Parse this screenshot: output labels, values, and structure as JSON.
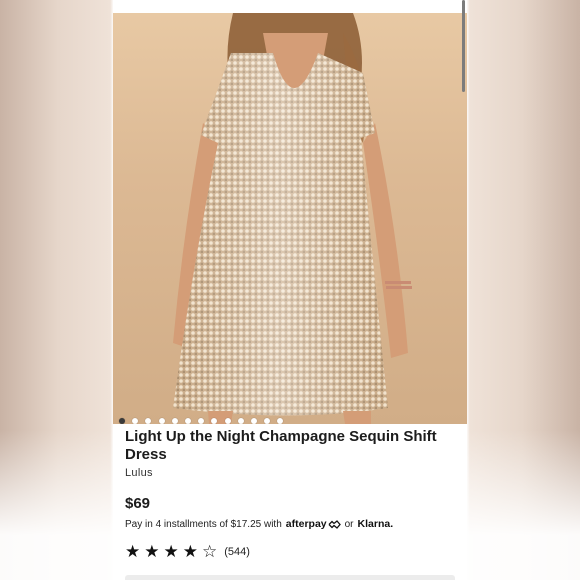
{
  "product": {
    "title": "Light Up the Night Champagne Sequin Shift Dress",
    "brand": "Lulus",
    "price": "$69",
    "installments_text": "Pay in 4 installments of $17.25 with",
    "afterpay_label": "afterpay",
    "or_label": "or",
    "klarna_label": "Klarna.",
    "rating_value": 4,
    "rating_max": 5,
    "review_count": "(544)"
  },
  "carousel": {
    "total_dots": 13,
    "active_index": 0
  },
  "icons": {
    "star_filled": "star-filled-icon",
    "star_empty": "star-empty-icon",
    "afterpay_logo": "afterpay-arrows-icon"
  },
  "colors": {
    "dress": "#d9bd9c",
    "background": "#dcb994",
    "text": "#1c1c1c"
  }
}
